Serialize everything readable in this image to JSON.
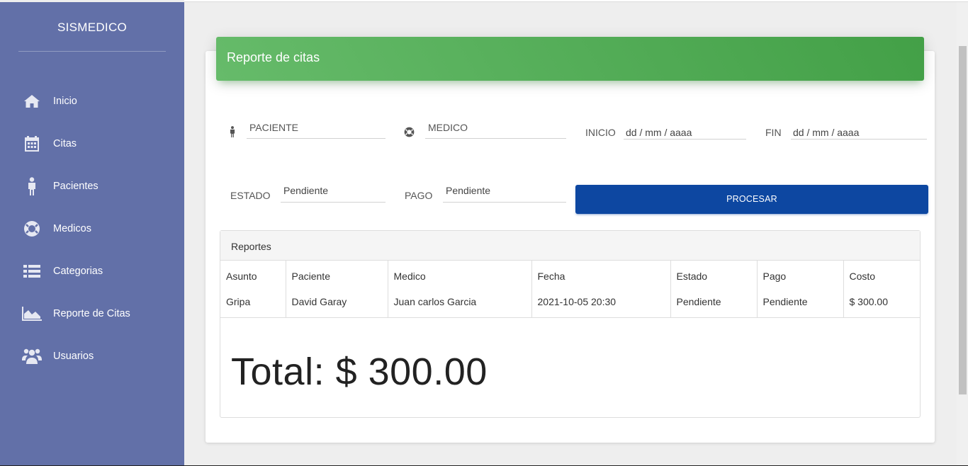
{
  "sidebar": {
    "brand": "SISMEDICO",
    "items": [
      {
        "label": "Inicio",
        "icon": "home-icon"
      },
      {
        "label": "Citas",
        "icon": "calendar-icon"
      },
      {
        "label": "Pacientes",
        "icon": "person-icon"
      },
      {
        "label": "Medicos",
        "icon": "life-ring-icon"
      },
      {
        "label": "Categorias",
        "icon": "list-icon"
      },
      {
        "label": "Reporte de Citas",
        "icon": "area-chart-icon"
      },
      {
        "label": "Usuarios",
        "icon": "users-icon"
      }
    ]
  },
  "card": {
    "title": "Reporte de citas"
  },
  "filters": {
    "paciente_placeholder": "PACIENTE",
    "medico_placeholder": "MEDICO",
    "inicio_label": "INICIO",
    "inicio_value": "dd / mm / aaaa",
    "fin_label": "FIN",
    "fin_value": "dd / mm / aaaa",
    "estado_label": "ESTADO",
    "estado_value": "Pendiente",
    "pago_label": "PAGO",
    "pago_value": "Pendiente",
    "process_button": "PROCESAR"
  },
  "report": {
    "title": "Reportes",
    "columns": [
      "Asunto",
      "Paciente",
      "Medico",
      "Fecha",
      "Estado",
      "Pago",
      "Costo"
    ],
    "rows": [
      [
        "Gripa",
        "David Garay",
        "Juan carlos Garcia",
        "2021-10-05 20:30",
        "Pendiente",
        "Pendiente",
        "$ 300.00"
      ]
    ],
    "total": "Total: $ 300.00"
  },
  "colors": {
    "sidebar": "#6270a8",
    "header_green": "#4caf50",
    "button_blue": "#0d47a1"
  }
}
